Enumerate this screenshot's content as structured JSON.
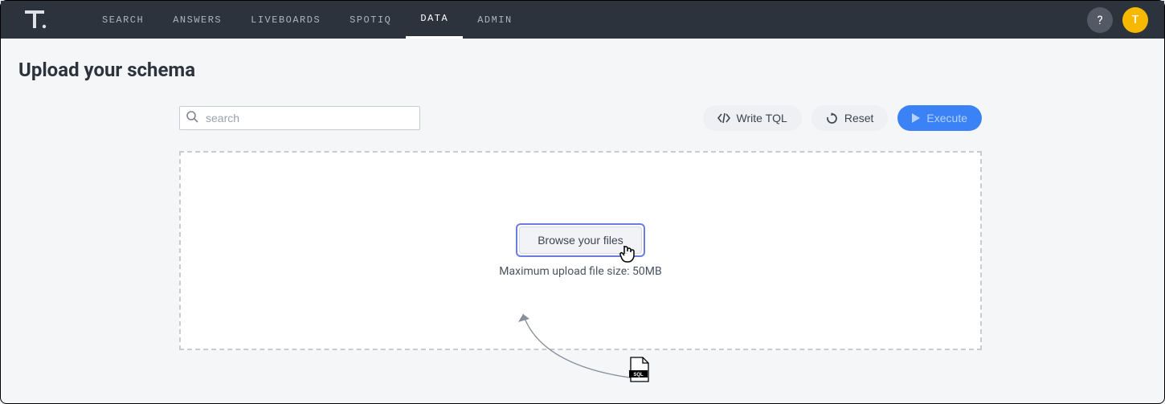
{
  "nav": {
    "items": [
      {
        "label": "SEARCH"
      },
      {
        "label": "ANSWERS"
      },
      {
        "label": "LIVEBOARDS"
      },
      {
        "label": "SPOTIQ"
      },
      {
        "label": "DATA"
      },
      {
        "label": "ADMIN"
      }
    ],
    "active_index": 4
  },
  "help": "?",
  "avatar_initial": "T",
  "page_title": "Upload your schema",
  "search": {
    "placeholder": "search"
  },
  "toolbar": {
    "write_tql": "Write TQL",
    "reset": "Reset",
    "execute": "Execute"
  },
  "dropzone": {
    "browse_label": "Browse your files",
    "hint": "Maximum upload file size: 50MB"
  },
  "file_icon_label": "SQL"
}
